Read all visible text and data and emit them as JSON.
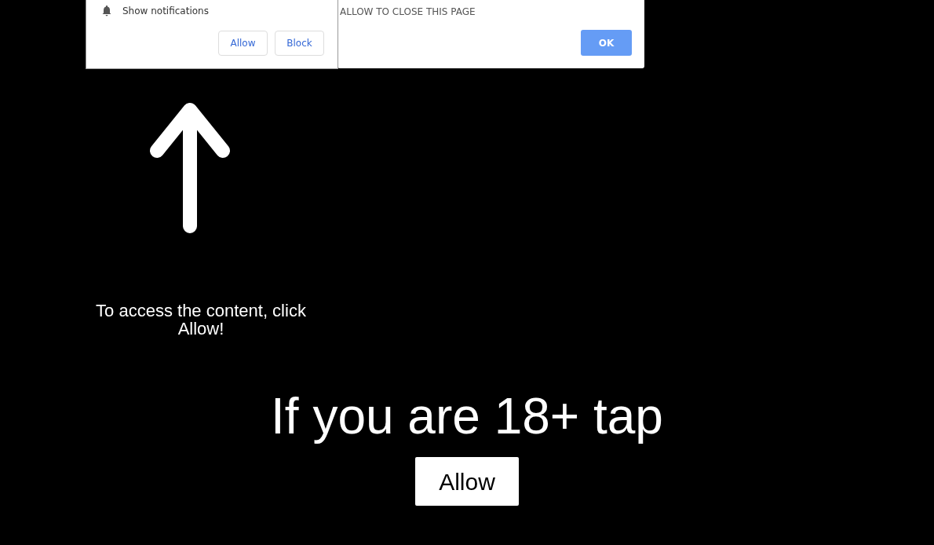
{
  "alert": {
    "message": "ALLOW TO CLOSE THIS PAGE",
    "button": "OK"
  },
  "notification_prompt": {
    "label": "Show notifications",
    "buttons": [
      "Allow",
      "Block"
    ]
  },
  "hint": "To access the content, click Allow!",
  "headline": "If you are 18+ tap",
  "button": "Allow"
}
